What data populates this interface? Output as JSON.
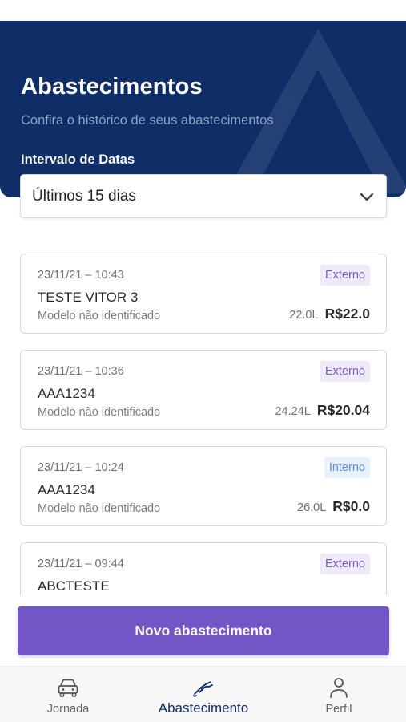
{
  "header": {
    "title": "Abastecimentos",
    "subtitle": "Confira o histórico de seus abastecimentos",
    "filter_label": "Intervalo de Datas"
  },
  "date_filter": {
    "selected": "Últimos 15 dias"
  },
  "records": [
    {
      "datetime": "23/11/21 – 10:43",
      "plate": "TESTE VITOR 3",
      "model": "Modelo não identificado",
      "type": "Externo",
      "liters": "22.0L",
      "price": "R$22.0"
    },
    {
      "datetime": "23/11/21 – 10:36",
      "plate": "AAA1234",
      "model": "Modelo não identificado",
      "type": "Externo",
      "liters": "24.24L",
      "price": "R$20.04"
    },
    {
      "datetime": "23/11/21 – 10:24",
      "plate": "AAA1234",
      "model": "Modelo não identificado",
      "type": "Interno",
      "liters": "26.0L",
      "price": "R$0.0"
    },
    {
      "datetime": "23/11/21 – 09:44",
      "plate": "ABCTESTE",
      "type": "Externo"
    }
  ],
  "actions": {
    "new_label": "Novo abastecimento"
  },
  "tabs": [
    {
      "label": "Jornada",
      "icon": "car-icon"
    },
    {
      "label": "Abastecimento",
      "icon": "fuel-nozzle-icon",
      "active": true
    },
    {
      "label": "Perfil",
      "icon": "user-icon"
    }
  ],
  "colors": {
    "header_bg": "#0f2d66",
    "primary_button": "#7256c6",
    "badge_externo": "#7b5bc4",
    "badge_interno": "#5a8fd6"
  }
}
